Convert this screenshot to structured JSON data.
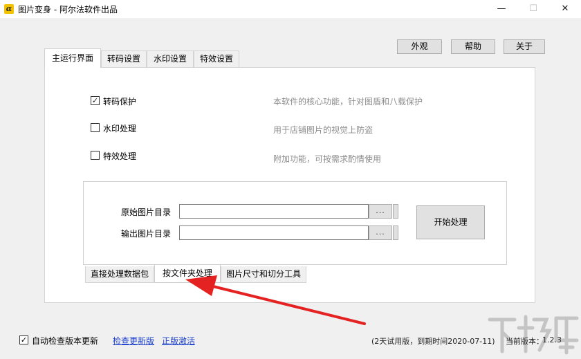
{
  "window": {
    "title": "图片变身 - 阿尔法软件出品",
    "app_icon_glyph": "α",
    "minimize_glyph": "—",
    "maximize_glyph": "☐",
    "close_glyph": "✕"
  },
  "top_buttons": {
    "skin": "外观",
    "help": "帮助",
    "about": "关于"
  },
  "tabs": [
    {
      "label": "主运行界面",
      "active": true
    },
    {
      "label": "转码设置",
      "active": false
    },
    {
      "label": "水印设置",
      "active": false
    },
    {
      "label": "特效设置",
      "active": false
    }
  ],
  "options": [
    {
      "label": "转码保护",
      "checked": true,
      "description": "本软件的核心功能，针对图盾和八载保护"
    },
    {
      "label": "水印处理",
      "checked": false,
      "description": "用于店铺图片的视觉上防盗"
    },
    {
      "label": "特效处理",
      "checked": false,
      "description": "附加功能，可按需求酌情使用"
    }
  ],
  "paths": {
    "source_label": "原始图片目录",
    "source_value": "",
    "output_label": "输出图片目录",
    "output_value": "",
    "browse_label": "..."
  },
  "start_button": "开始处理",
  "subtabs": [
    {
      "label": "直接处理数据包",
      "active": false
    },
    {
      "label": "按文件夹处理",
      "active": true
    },
    {
      "label": "图片尺寸和切分工具",
      "active": false
    }
  ],
  "footer": {
    "auto_check_label": "自动检查版本更新",
    "auto_check_checked": true,
    "check_update_link": "检查更新版",
    "activate_link": "正版激活",
    "trial_info": "(2天试用版，到期时间2020-07-11)",
    "version_label": "当前版本：",
    "version_value": "1.2.3"
  },
  "colors": {
    "arrow": "#e52222",
    "link": "#1a3fcc",
    "description_text": "#8c8c8c",
    "app_icon": "#f3c200"
  },
  "icons": {
    "arrow": "red-arrow-annotation",
    "watermark": "xiazaiba-watermark-logo"
  }
}
